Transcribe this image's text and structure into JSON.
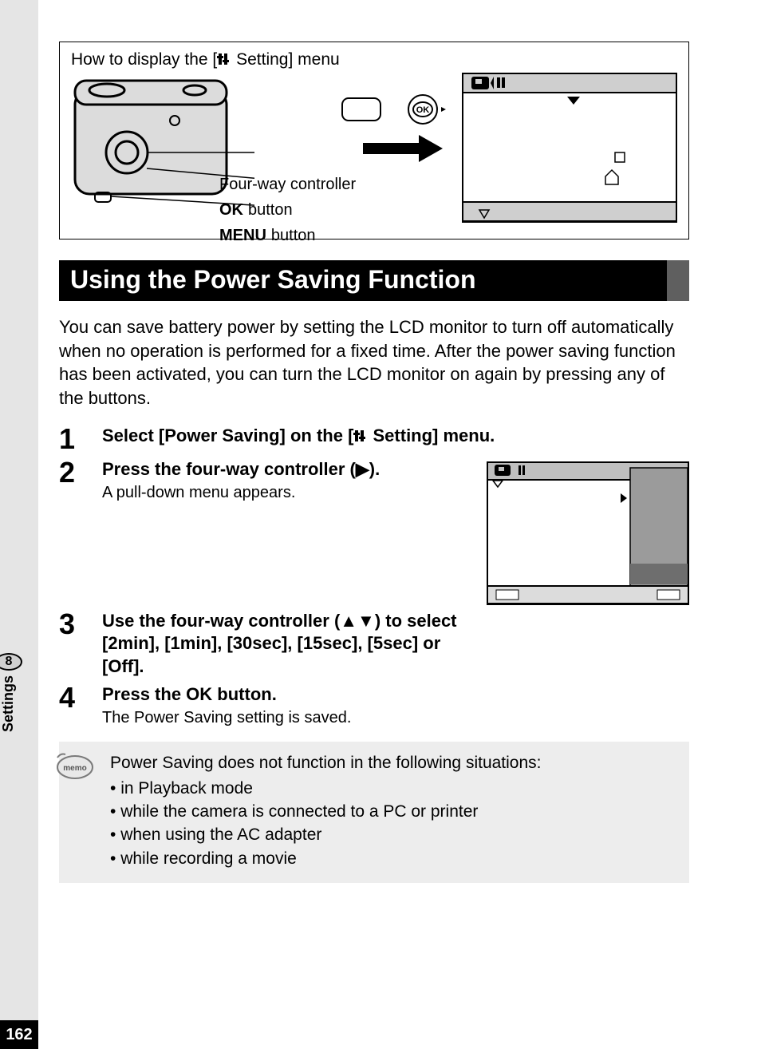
{
  "page_number": "162",
  "side_tab": {
    "number": "8",
    "label": "Settings"
  },
  "howto": {
    "title_pre": "How to display the [",
    "title_post": " Setting] menu",
    "callout_controller": "Four-way controller",
    "callout_ok_bold": "OK",
    "callout_ok_rest": " button",
    "callout_menu_bold": "MENU",
    "callout_menu_rest": " button",
    "ok_label": "OK"
  },
  "section_title": "Using the Power Saving Function",
  "intro": "You can save battery power by setting the LCD monitor to turn off automatically when no operation is performed for a fixed time. After the power saving function has been activated, you can turn the LCD monitor on again by pressing any of the buttons.",
  "steps": [
    {
      "n": "1",
      "heading_pre": "Select [Power Saving] on the [",
      "heading_post": " Setting] menu.",
      "sub": ""
    },
    {
      "n": "2",
      "heading": "Press the four-way controller (▶).",
      "sub": "A pull-down menu appears."
    },
    {
      "n": "3",
      "heading": "Use the four-way controller (▲▼) to select [2min], [1min], [30sec], [15sec], [5sec] or [Off].",
      "sub": ""
    },
    {
      "n": "4",
      "heading_pre": "Press the ",
      "heading_bold": "OK",
      "heading_post": " button.",
      "sub": "The Power Saving setting is saved."
    }
  ],
  "memo": {
    "badge": "memo",
    "lead": "Power Saving does not function in the following situations:",
    "items": [
      "in Playback mode",
      "while the camera is connected to a PC or printer",
      "when using the AC adapter",
      "while recording a movie"
    ]
  }
}
